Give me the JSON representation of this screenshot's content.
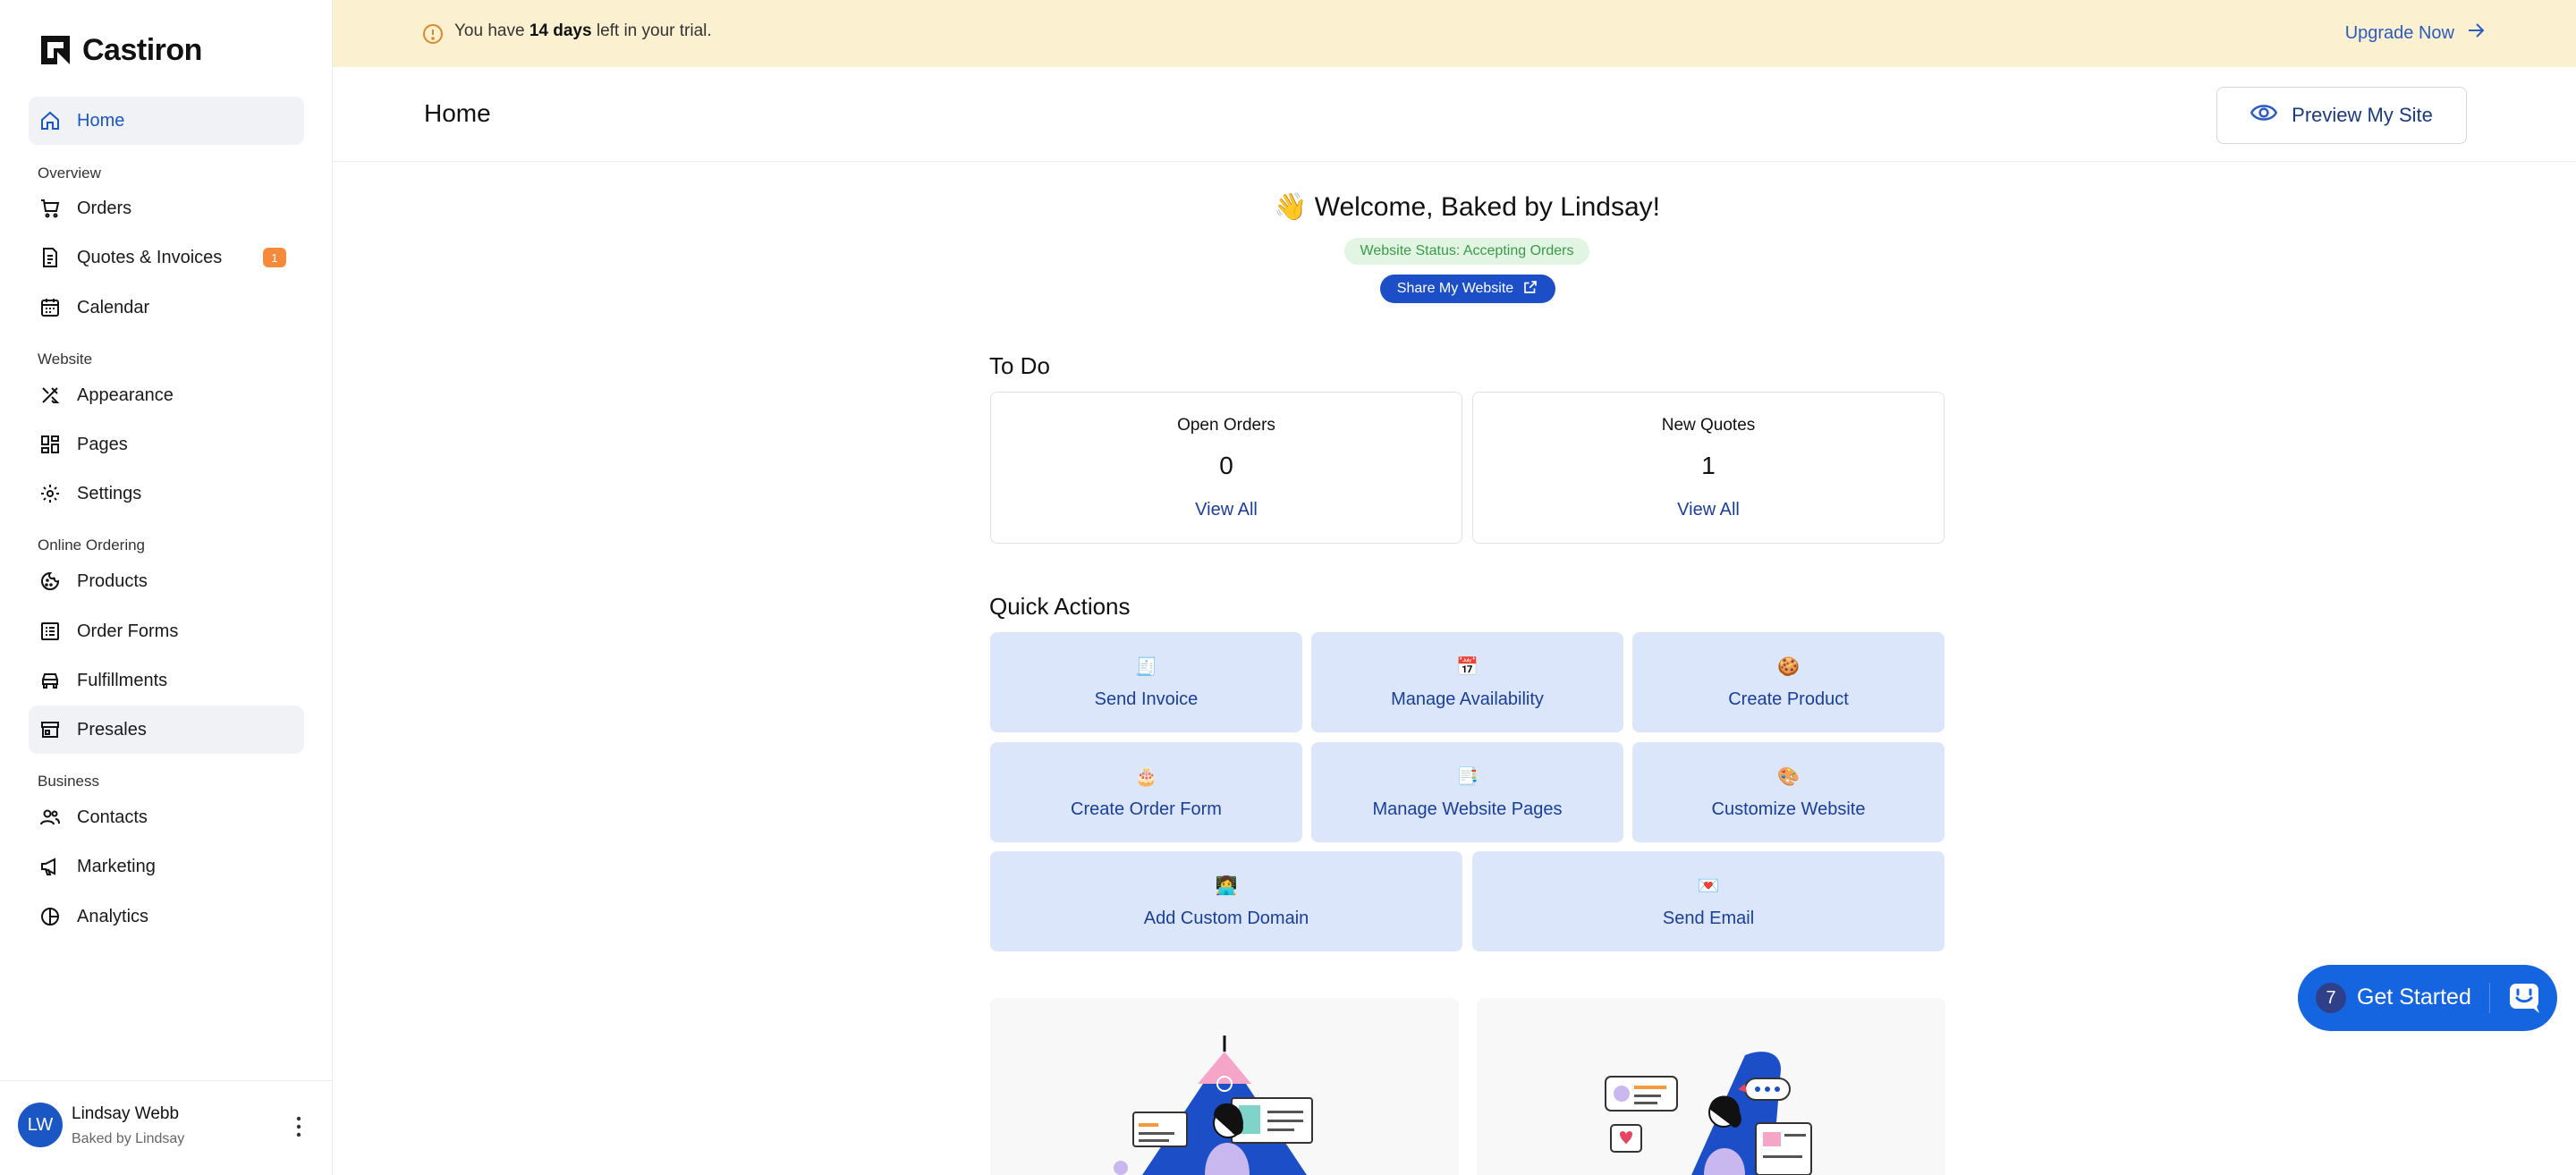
{
  "app": {
    "name": "Castiron"
  },
  "banner": {
    "text_before": "You have ",
    "text_bold": "14 days",
    "text_after": " left in your trial.",
    "upgrade_label": "Upgrade Now"
  },
  "sidebar": {
    "home": "Home",
    "sections": {
      "overview": "Overview",
      "website": "Website",
      "online_ordering": "Online Ordering",
      "business": "Business"
    },
    "items": {
      "orders": "Orders",
      "quotes": "Quotes & Invoices",
      "quotes_badge": "1",
      "calendar": "Calendar",
      "appearance": "Appearance",
      "pages": "Pages",
      "settings": "Settings",
      "products": "Products",
      "order_forms": "Order Forms",
      "fulfillments": "Fulfillments",
      "presales": "Presales",
      "contacts": "Contacts",
      "marketing": "Marketing",
      "analytics": "Analytics"
    },
    "user": {
      "initials": "LW",
      "name": "Lindsay Webb",
      "business": "Baked by Lindsay"
    }
  },
  "header": {
    "title": "Home",
    "preview_label": "Preview My Site"
  },
  "welcome": {
    "emoji": "👋",
    "text": "Welcome, Baked by Lindsay!",
    "status": "Website Status: Accepting Orders",
    "share_label": "Share My Website"
  },
  "todo": {
    "title": "To Do",
    "cards": [
      {
        "label": "Open Orders",
        "count": "0",
        "link": "View All"
      },
      {
        "label": "New Quotes",
        "count": "1",
        "link": "View All"
      }
    ]
  },
  "quick_actions": {
    "title": "Quick Actions",
    "items": [
      {
        "emoji": "🧾",
        "label": "Send Invoice"
      },
      {
        "emoji": "📅",
        "label": "Manage Availability"
      },
      {
        "emoji": "🍪",
        "label": "Create Product"
      },
      {
        "emoji": "🎂",
        "label": "Create Order Form"
      },
      {
        "emoji": "📑",
        "label": "Manage Website Pages"
      },
      {
        "emoji": "🎨",
        "label": "Customize Website"
      },
      {
        "emoji": "👩‍💻",
        "label": "Add Custom Domain"
      },
      {
        "emoji": "💌",
        "label": "Send Email"
      }
    ]
  },
  "get_started": {
    "count": "7",
    "label": "Get Started"
  },
  "colors": {
    "accent": "#1c4fc7",
    "banner": "#fbf0cf",
    "quick_action_bg": "#dbe6fa",
    "badge": "#f58a3a"
  }
}
